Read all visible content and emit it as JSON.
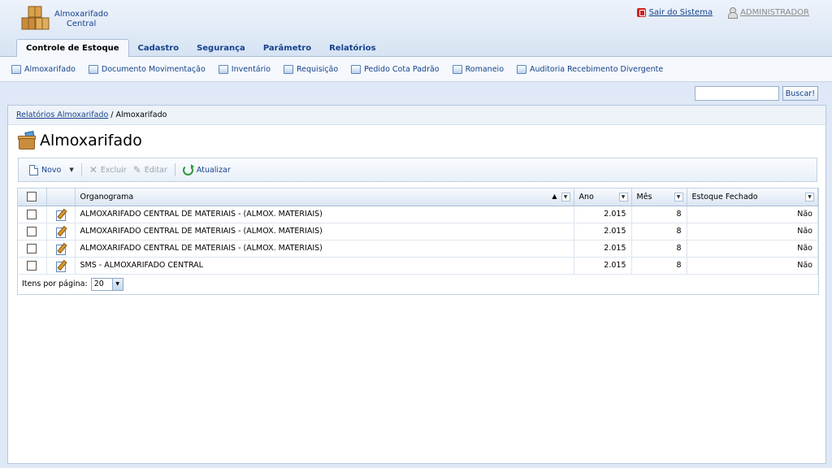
{
  "app": {
    "name_line1": "Almoxarifado",
    "name_line2": "Central"
  },
  "top_links": {
    "exit": "Sair do Sistema",
    "user": "ADMINISTRADOR"
  },
  "tabs": [
    {
      "label": "Controle de Estoque",
      "active": true
    },
    {
      "label": "Cadastro"
    },
    {
      "label": "Segurança"
    },
    {
      "label": "Parâmetro"
    },
    {
      "label": "Relatórios"
    }
  ],
  "submenu": [
    "Almoxarifado",
    "Documento Movimentação",
    "Inventário",
    "Requisição",
    "Pedido Cota Padrão",
    "Romaneio",
    "Auditoria Recebimento Divergente"
  ],
  "search": {
    "value": "",
    "button": "Buscar!"
  },
  "breadcrumb": {
    "link": "Relatórios Almoxarifado",
    "separator": "/",
    "current": "Almoxarifado"
  },
  "page_title": "Almoxarifado",
  "toolbar": {
    "new": "Novo",
    "delete": "Excluir",
    "edit": "Editar",
    "refresh": "Atualizar"
  },
  "grid": {
    "columns": {
      "org": "Organograma",
      "year": "Ano",
      "month": "Mês",
      "closed": "Estoque Fechado"
    },
    "rows": [
      {
        "org": "ALMOXARIFADO CENTRAL DE MATERIAIS - (ALMOX. MATERIAIS)",
        "year": "2.015",
        "month": "8",
        "closed": "Não"
      },
      {
        "org": "ALMOXARIFADO CENTRAL DE MATERIAIS - (ALMOX. MATERIAIS)",
        "year": "2.015",
        "month": "8",
        "closed": "Não"
      },
      {
        "org": "ALMOXARIFADO CENTRAL DE MATERIAIS - (ALMOX. MATERIAIS)",
        "year": "2.015",
        "month": "8",
        "closed": "Não"
      },
      {
        "org": "SMS - ALMOXARIFADO CENTRAL",
        "year": "2.015",
        "month": "8",
        "closed": "Não"
      }
    ]
  },
  "pager": {
    "label": "Itens por página:",
    "value": "20"
  },
  "colors": {
    "brand": "#15428b",
    "header_bg": "#dfe8f6"
  }
}
